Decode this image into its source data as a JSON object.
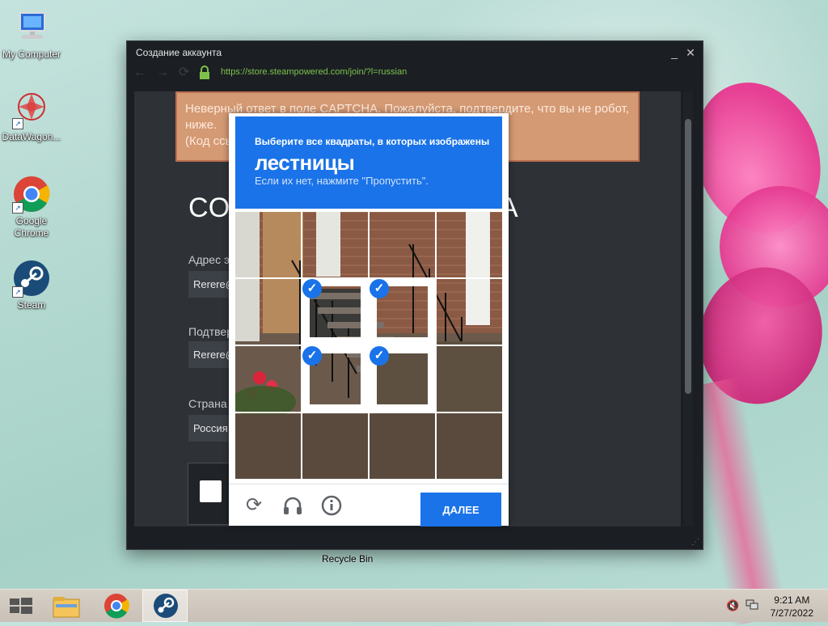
{
  "desktop": {
    "icons": [
      {
        "label": "My Computer"
      },
      {
        "label": "DataWagon..."
      },
      {
        "label": "Google Chrome"
      },
      {
        "label": "Steam"
      }
    ],
    "recycle_bin_label": "Recycle Bin"
  },
  "window": {
    "title": "Создание аккаунта",
    "minimize": "_",
    "close": "✕",
    "url": "https://store.steampowered.com/join/?l=russian"
  },
  "page": {
    "error_lines": [
      "Неверный ответ в поле CAPTCHA. Пожалуйста, подтвердите, что вы не робот,",
      "ниже.",
      "(Код ссы"
    ],
    "heading_start": "СО",
    "heading_end": "А",
    "email_label": "Адрес э",
    "email_value": "Rerere@",
    "confirm_label": "Подтвер",
    "confirm_value": "Rerere@",
    "country_label": "Страна",
    "country_value": "Россия"
  },
  "captcha": {
    "instruction": "Выберите все квадраты, в которых изображены",
    "keyword": "лестницы",
    "hint": "Если их нет, нажмите \"Пропустить\".",
    "next_label": "ДАЛЕЕ",
    "selected_tiles": [
      5,
      6,
      9,
      10
    ],
    "accent": "#1a73e8"
  },
  "taskbar": {
    "time": "9:21 AM",
    "date": "7/27/2022"
  },
  "colors": {
    "error_bg": "#d49a74",
    "url_green": "#7ec24b"
  }
}
